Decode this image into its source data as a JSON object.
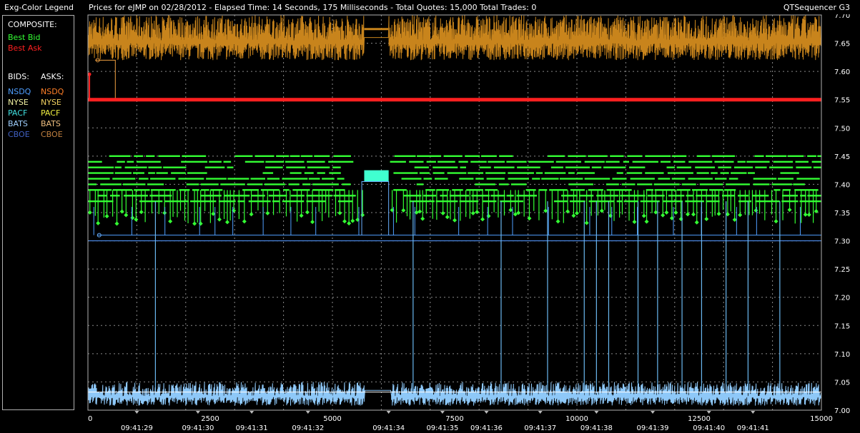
{
  "header": {
    "legend_title": "Exg-Color Legend",
    "chart_title": "Prices for  eJMP  on  02/28/2012  -  Elapsed Time: 14 Seconds, 175 Milliseconds  -  Total Quotes: 15,000  Total Trades: 0",
    "app_name": "QTSequencer G3"
  },
  "legend": {
    "composite_label": "COMPOSITE:",
    "best_bid": {
      "label": "Best Bid",
      "color": "#33ff33"
    },
    "best_ask": {
      "label": "Best Ask",
      "color": "#ff2020"
    },
    "bids_label": "BIDS:",
    "asks_label": "ASKS:",
    "bids": [
      {
        "label": "NSDQ",
        "color": "#4f9fff"
      },
      {
        "label": "NYSE",
        "color": "#f0f0a0"
      },
      {
        "label": "PACF",
        "color": "#40e0e0"
      },
      {
        "label": "BATS",
        "color": "#a0d0ff"
      },
      {
        "label": "CBOE",
        "color": "#4060c0"
      }
    ],
    "asks": [
      {
        "label": "NSDQ",
        "color": "#ff7f27"
      },
      {
        "label": "NYSE",
        "color": "#f0d060"
      },
      {
        "label": "PACF",
        "color": "#f0f040"
      },
      {
        "label": "BATS",
        "color": "#f0c080"
      },
      {
        "label": "CBOE",
        "color": "#c08040"
      }
    ]
  },
  "chart_data": {
    "type": "line",
    "title": "Prices for  eJMP  on  02/28/2012",
    "x_label": "",
    "y_label": "",
    "xlim": [
      0,
      15000
    ],
    "ylim": [
      7.0,
      7.7
    ],
    "grid": true,
    "y_ticks": [
      "7.00",
      "7.05",
      "7.10",
      "7.15",
      "7.20",
      "7.25",
      "7.30",
      "7.35",
      "7.40",
      "7.45",
      "7.50",
      "7.55",
      "7.60",
      "7.65",
      "7.70"
    ],
    "x_ticks": [
      "0",
      "2500",
      "5000",
      "7500",
      "10000",
      "12500",
      "15000"
    ],
    "time_labels": [
      "09:41:29",
      "09:41:30",
      "09:41:31",
      "09:41:32",
      "09:41:34",
      "09:41:35",
      "09:41:36",
      "09:41:37",
      "09:41:38",
      "09:41:39",
      "09:41:40",
      "09:41:41"
    ],
    "time_label_x": [
      1000,
      2250,
      3350,
      4500,
      6150,
      7250,
      8150,
      9250,
      10400,
      11550,
      12700,
      13600
    ],
    "series": [
      {
        "name": "Best Ask",
        "color": "#ff2020",
        "x": [
          0,
          15000
        ],
        "y": [
          7.55,
          7.55
        ]
      },
      {
        "name": "Best Bid",
        "color": "#33ff33",
        "x": [
          0,
          15000
        ],
        "y_range": [
          7.33,
          7.45
        ]
      },
      {
        "name": "NSDQ",
        "color": "#4f9fff",
        "x": [
          0,
          15000
        ],
        "y": [
          7.3,
          7.31
        ]
      }
    ]
  }
}
